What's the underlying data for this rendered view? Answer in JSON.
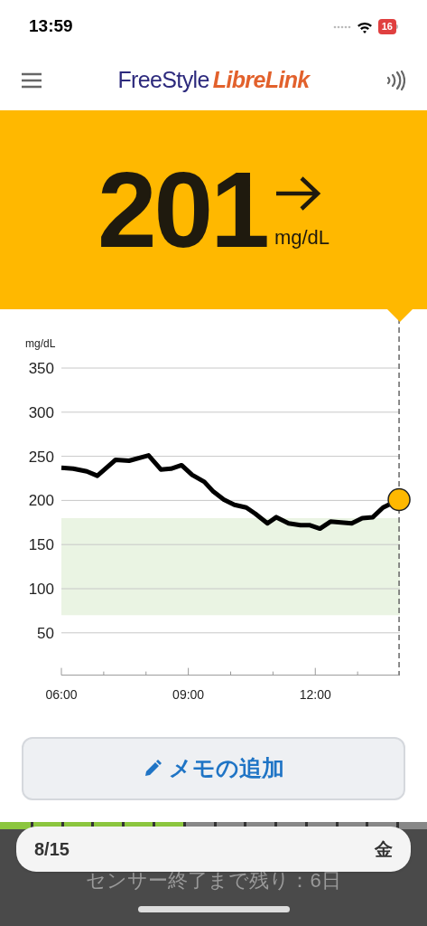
{
  "status_bar": {
    "time": "13:59",
    "battery": "16"
  },
  "header": {
    "logo_first": "FreeStyle",
    "logo_second": "LibreLink"
  },
  "reading": {
    "value": "201",
    "unit": "mg/dL"
  },
  "chart": {
    "chart_data": {
      "type": "line",
      "ylabel": "mg/dL",
      "xlim": [
        6,
        14
      ],
      "ylim": [
        0,
        350
      ],
      "xticks": [
        {
          "value": 6,
          "label": "06:00"
        },
        {
          "value": 9,
          "label": "09:00"
        },
        {
          "value": 12,
          "label": "12:00"
        }
      ],
      "yticks": [
        50,
        100,
        150,
        200,
        250,
        300,
        350
      ],
      "grid": true,
      "x": [
        6.0,
        6.28,
        6.6,
        6.85,
        7.28,
        7.6,
        8.06,
        8.35,
        8.59,
        8.84,
        9.09,
        9.38,
        9.59,
        9.84,
        10.09,
        10.37,
        10.58,
        10.87,
        11.08,
        11.37,
        11.65,
        11.86,
        12.11,
        12.36,
        12.61,
        12.86,
        13.11,
        13.36,
        13.6,
        13.98
      ],
      "series": [
        {
          "color": "#000000",
          "values": [
            237,
            236,
            233,
            228,
            246,
            245,
            251,
            235,
            236,
            240,
            229,
            221,
            210,
            201,
            195,
            192,
            185,
            174,
            181,
            174,
            172,
            172,
            168,
            176,
            175,
            174,
            180,
            181,
            192,
            201
          ]
        }
      ],
      "bands": [
        {
          "axis": "y",
          "from": 70,
          "to": 180,
          "color": "#eaf4e3"
        }
      ]
    }
  },
  "memo_button": {
    "label": "メモの追加"
  },
  "sensor": {
    "level": 0.43,
    "remaining": "センサー終了まで残り：6日"
  },
  "date_bar": {
    "date": "8/15",
    "weekday": "金"
  }
}
